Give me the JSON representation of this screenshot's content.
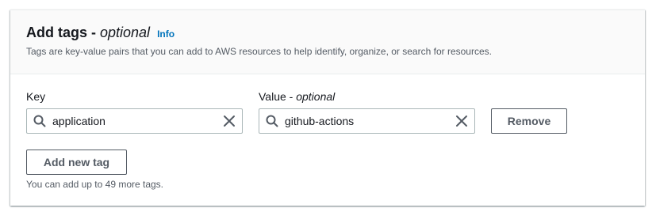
{
  "header": {
    "title": "Add tags -",
    "title_optional": "optional",
    "info_link": "Info",
    "description": "Tags are key-value pairs that you can add to AWS resources to help identify, organize, or search for resources."
  },
  "tag_row": {
    "key_label": "Key",
    "value_label": "Value -",
    "value_label_optional": "optional",
    "key_value": "application",
    "value_value": "github-actions",
    "remove_label": "Remove"
  },
  "footer": {
    "add_tag_label": "Add new tag",
    "limit_text": "You can add up to 49 more tags."
  },
  "icons": {
    "search": "search-icon",
    "clear": "close-icon"
  },
  "colors": {
    "link": "#0073bb",
    "border": "#aab7b8",
    "button_border": "#545b64",
    "header_bg": "#fafafa"
  }
}
